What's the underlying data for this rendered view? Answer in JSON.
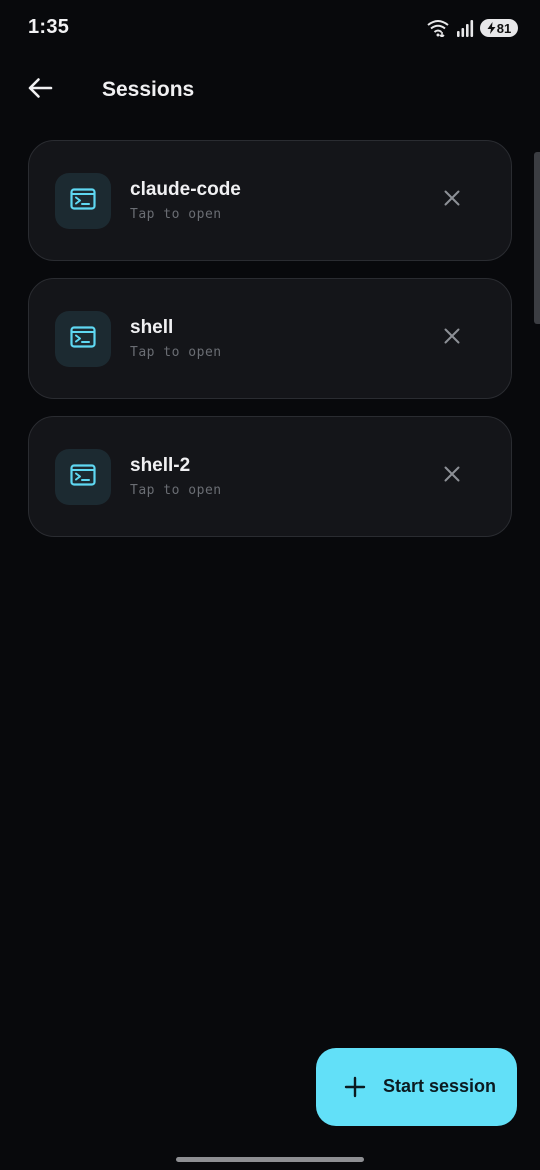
{
  "status_bar": {
    "time": "1:35",
    "battery_level": "81",
    "icons": [
      "wifi-icon",
      "signal-icon",
      "battery-charging-icon"
    ]
  },
  "app_bar": {
    "title": "Sessions",
    "back_icon": "arrow-left-icon"
  },
  "sessions": [
    {
      "name": "claude-code",
      "subtitle": "Tap to open",
      "icon": "terminal-icon",
      "close_icon": "close-icon"
    },
    {
      "name": "shell",
      "subtitle": "Tap to open",
      "icon": "terminal-icon",
      "close_icon": "close-icon"
    },
    {
      "name": "shell-2",
      "subtitle": "Tap to open",
      "icon": "terminal-icon",
      "close_icon": "close-icon"
    }
  ],
  "fab": {
    "label": "Start session",
    "icon": "plus-icon"
  },
  "colors": {
    "background": "#08090c",
    "card": "#141519",
    "card_border": "#2a2c31",
    "accent": "#62e0f8",
    "icon_tile": "#1c2a31",
    "muted_text": "#6a6d73"
  }
}
